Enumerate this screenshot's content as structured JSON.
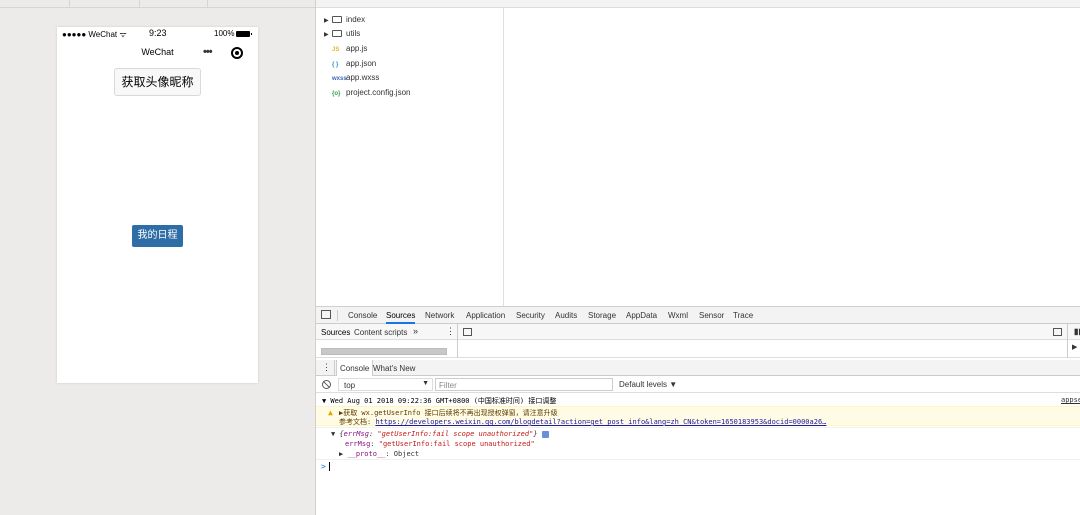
{
  "phone": {
    "carrier": "●●●●● WeChat ᯤ",
    "time": "9:23",
    "battery": "100%",
    "nav_title": "WeChat",
    "menu_dots": "•••",
    "avatar_button": "获取头像昵称",
    "schedule_button": "我的日程"
  },
  "file_tree": [
    {
      "type": "folder",
      "name": "index"
    },
    {
      "type": "folder",
      "name": "utils"
    },
    {
      "type": "js",
      "icon": "JS",
      "name": "app.js"
    },
    {
      "type": "json",
      "icon": "{ }",
      "name": "app.json"
    },
    {
      "type": "wxss",
      "icon": "wxss",
      "name": "app.wxss"
    },
    {
      "type": "config",
      "icon": "{o}",
      "name": "project.config.json"
    }
  ],
  "devtools": {
    "tabs": [
      "Console",
      "Sources",
      "Network",
      "Application",
      "Security",
      "Audits",
      "Storage",
      "AppData",
      "Wxml",
      "Sensor",
      "Trace"
    ],
    "active_tab": "Sources",
    "sources_nav": {
      "sources": "Sources",
      "content_scripts": "Content scripts",
      "more": "»"
    },
    "drawer_tabs": {
      "console": "Console",
      "whats_new": "What's New"
    },
    "context": "top",
    "filter_placeholder": "Filter",
    "levels": "Default levels ▼",
    "log": {
      "line1": "▼ Wed Aug 01 2018 09:22:36 GMT+0800 (中国标准时间) 接口调整",
      "source": "appse",
      "warn_line1": "▶获取 wx.getUserInfo 接口后续将不再出现授权弹窗，请注意升级",
      "warn_line2_label": "参考文档: ",
      "warn_link": "https://developers.weixin.qq.com/blogdetail?action=get_post_info&lang=zh_CN&token=1650183953&docid=0000a26…",
      "obj_prefix": "▼ {",
      "obj_key": "errMsg",
      "obj_value": "\"getUserInfo:fail scope unauthorized\"",
      "obj_suffix": "}",
      "errmsg_key": "errMsg",
      "errmsg_value": "\"getUserInfo:fail scope unauthorized\"",
      "proto_arrow": "▶ ",
      "proto_key": "__proto__",
      "proto_value": ": Object",
      "prompt": ">"
    }
  }
}
